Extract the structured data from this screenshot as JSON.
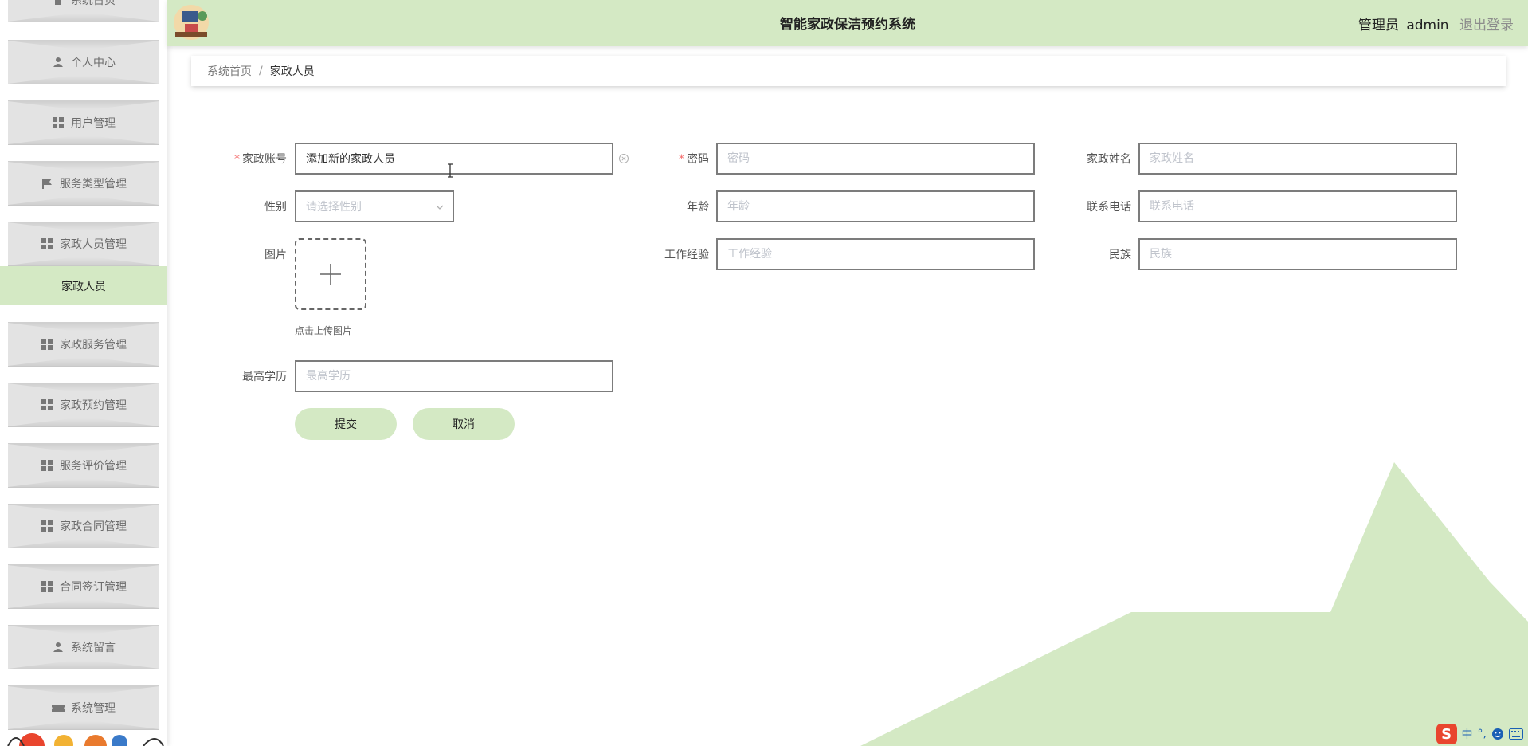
{
  "header": {
    "title": "智能家政保洁预约系统",
    "user_label": "管理员",
    "user_name": "admin",
    "logout": "退出登录"
  },
  "sidebar": {
    "items": [
      {
        "label": "系统首页",
        "icon": "home-icon"
      },
      {
        "label": "个人中心",
        "icon": "person-icon"
      },
      {
        "label": "用户管理",
        "icon": "grid-icon"
      },
      {
        "label": "服务类型管理",
        "icon": "flag-icon"
      },
      {
        "label": "家政人员管理",
        "icon": "grid-icon"
      },
      {
        "label": "家政服务管理",
        "icon": "grid-icon"
      },
      {
        "label": "家政预约管理",
        "icon": "grid-icon"
      },
      {
        "label": "服务评价管理",
        "icon": "grid-icon"
      },
      {
        "label": "家政合同管理",
        "icon": "grid-icon"
      },
      {
        "label": "合同签订管理",
        "icon": "grid-icon"
      },
      {
        "label": "系统留言",
        "icon": "person-icon"
      },
      {
        "label": "系统管理",
        "icon": "ticket-icon"
      }
    ],
    "active_sub": "家政人员"
  },
  "breadcrumb": {
    "home": "系统首页",
    "separator": "/",
    "current": "家政人员"
  },
  "form": {
    "account": {
      "label": "家政账号",
      "value": "添加新的家政人员",
      "required": true
    },
    "password": {
      "label": "密码",
      "placeholder": "密码",
      "required": true
    },
    "name": {
      "label": "家政姓名",
      "placeholder": "家政姓名"
    },
    "gender": {
      "label": "性别",
      "placeholder": "请选择性别"
    },
    "age": {
      "label": "年龄",
      "placeholder": "年龄"
    },
    "phone": {
      "label": "联系电话",
      "placeholder": "联系电话"
    },
    "picture": {
      "label": "图片",
      "hint": "点击上传图片"
    },
    "experience": {
      "label": "工作经验",
      "placeholder": "工作经验"
    },
    "ethnicity": {
      "label": "民族",
      "placeholder": "民族"
    },
    "education": {
      "label": "最高学历",
      "placeholder": "最高学历"
    },
    "submit": "提交",
    "cancel": "取消"
  },
  "colors": {
    "accent": "#d4e9c4",
    "menu_bg": "#e3e3e3",
    "required": "#f56c6c"
  },
  "ime": {
    "chinese": "中",
    "punct": "°,"
  }
}
